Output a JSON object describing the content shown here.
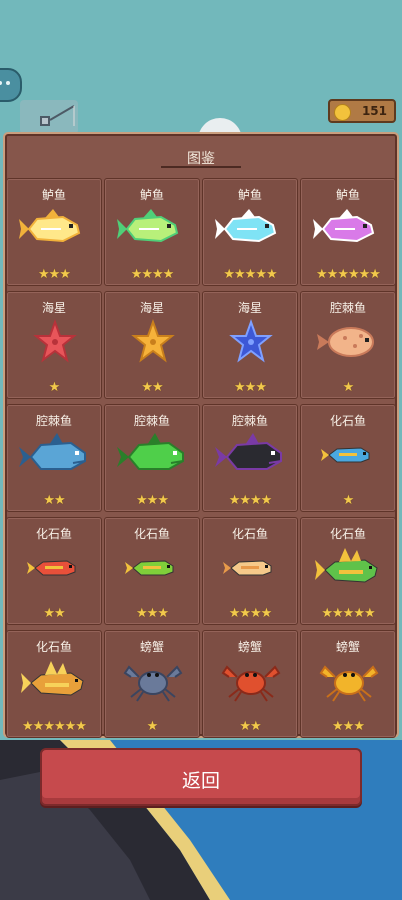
{
  "hud": {
    "coins": "151"
  },
  "collection": {
    "title": "图鉴",
    "cards": [
      {
        "name": "鲈鱼",
        "stars": "★★★",
        "kind": "fish",
        "body": "#ffe88a",
        "accent": "#f2b23a"
      },
      {
        "name": "鲈鱼",
        "stars": "★★★★",
        "kind": "fish",
        "body": "#b8f07a",
        "accent": "#4fcf78"
      },
      {
        "name": "鲈鱼",
        "stars": "★★★★★",
        "kind": "fish",
        "body": "#7fe3f5",
        "accent": "#ffffff"
      },
      {
        "name": "鲈鱼",
        "stars": "★★★★★★",
        "kind": "fish",
        "body": "#d97ae8",
        "accent": "#ffffff"
      },
      {
        "name": "海星",
        "stars": "★",
        "kind": "star",
        "body": "#e8555a",
        "accent": "#b8323a"
      },
      {
        "name": "海星",
        "stars": "★★",
        "kind": "star",
        "body": "#f6b23a",
        "accent": "#c97f1c"
      },
      {
        "name": "海星",
        "stars": "★★★",
        "kind": "star",
        "body": "#3d58d6",
        "accent": "#7fa0ff"
      },
      {
        "name": "腔棘鱼",
        "stars": "★",
        "kind": "puffer",
        "body": "#f2b48a",
        "accent": "#c97a5a"
      },
      {
        "name": "腔棘鱼",
        "stars": "★★",
        "kind": "bigfish",
        "body": "#5aa5d6",
        "accent": "#2b5f8f"
      },
      {
        "name": "腔棘鱼",
        "stars": "★★★",
        "kind": "bigfish",
        "body": "#4fcf4a",
        "accent": "#2a7f2a"
      },
      {
        "name": "腔棘鱼",
        "stars": "★★★★",
        "kind": "bigfish",
        "body": "#2a2a30",
        "accent": "#7a3aa5"
      },
      {
        "name": "化石鱼",
        "stars": "★",
        "kind": "small",
        "body": "#4aa8e0",
        "accent": "#f2c23c"
      },
      {
        "name": "化石鱼",
        "stars": "★★",
        "kind": "small",
        "body": "#e8503a",
        "accent": "#f2c23c"
      },
      {
        "name": "化石鱼",
        "stars": "★★★",
        "kind": "small",
        "body": "#7fcf3a",
        "accent": "#f2c23c"
      },
      {
        "name": "化石鱼",
        "stars": "★★★★",
        "kind": "small",
        "body": "#f5c98a",
        "accent": "#e89a4a"
      },
      {
        "name": "化石鱼",
        "stars": "★★★★★",
        "kind": "fossil",
        "body": "#5fc24a",
        "accent": "#f2c23c"
      },
      {
        "name": "化石鱼",
        "stars": "★★★★★★",
        "kind": "fossil",
        "body": "#e8a03a",
        "accent": "#f7d25a"
      },
      {
        "name": "螃蟹",
        "stars": "★",
        "kind": "crab",
        "body": "#6a7a9a",
        "accent": "#3a4560"
      },
      {
        "name": "螃蟹",
        "stars": "★★",
        "kind": "crab",
        "body": "#e0502e",
        "accent": "#8a2a1a"
      },
      {
        "name": "螃蟹",
        "stars": "★★★",
        "kind": "crab",
        "body": "#f2b42a",
        "accent": "#c9701a"
      }
    ]
  },
  "back_label": "返回"
}
